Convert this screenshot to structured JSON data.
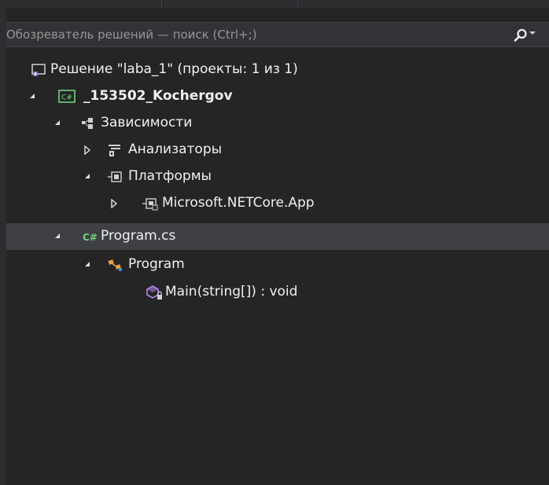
{
  "search": {
    "placeholder": "Обозреватель решений — поиск (Ctrl+;)"
  },
  "colors": {
    "background": "#252526",
    "selected_row": "#3f3f46",
    "text": "#f1f1f1",
    "placeholder": "#969696",
    "csharp_green": "#6fd37a",
    "vs_purple": "#8a63d2"
  },
  "tree": {
    "items": [
      {
        "label": "Решение \"laba_1\" (проекты: 1 из 1)",
        "icon": "solution-icon",
        "expander": "none"
      },
      {
        "label": "_153502_Kochergov",
        "icon": "csharp-project-icon",
        "expander": "expanded"
      },
      {
        "label": "Зависимости",
        "icon": "dependencies-icon",
        "expander": "expanded"
      },
      {
        "label": "Анализаторы",
        "icon": "analyzers-icon",
        "expander": "collapsed"
      },
      {
        "label": "Платформы",
        "icon": "frameworks-icon",
        "expander": "expanded"
      },
      {
        "label": "Microsoft.NETCore.App",
        "icon": "framework-reference-icon",
        "expander": "collapsed"
      },
      {
        "label": "Program.cs",
        "icon": "csharp-file-icon",
        "expander": "expanded",
        "selected": true
      },
      {
        "label": "Program",
        "icon": "class-icon",
        "expander": "expanded"
      },
      {
        "label": "Main(string[]) : void",
        "icon": "private-method-icon",
        "expander": "none"
      }
    ]
  }
}
